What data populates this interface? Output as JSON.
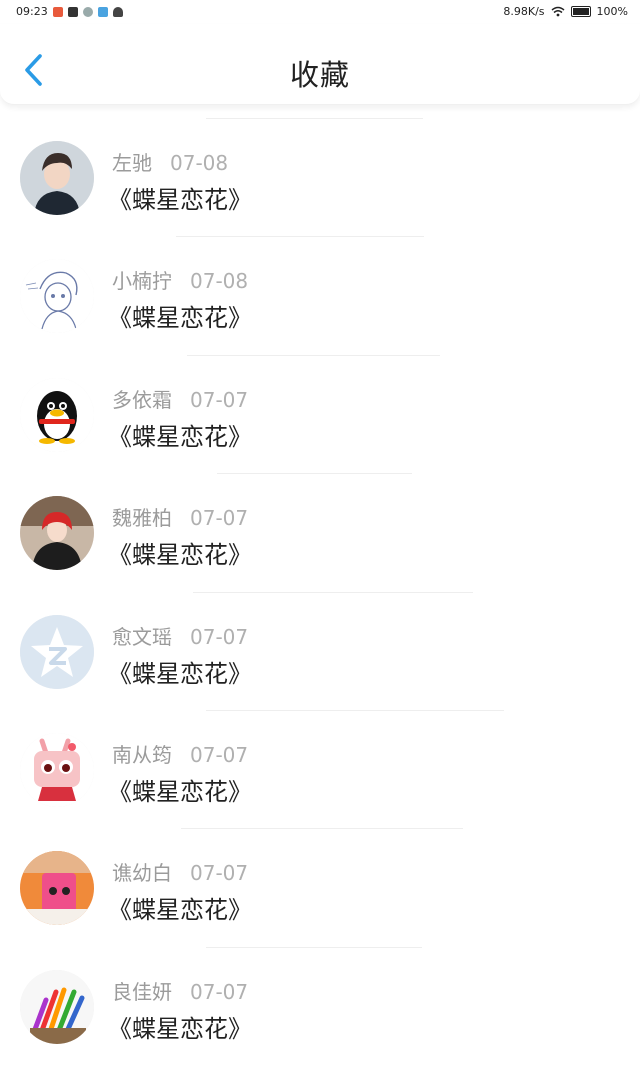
{
  "status_bar": {
    "time": "09:23",
    "network_speed": "8.98K/s",
    "battery": "100%"
  },
  "header": {
    "title": "收藏",
    "back_icon": "chevron-left-icon",
    "accent_color": "#2a9be6"
  },
  "items": [
    {
      "user": "左驰",
      "date": "07-08",
      "title": "《蝶星恋花》",
      "avatar": "photo-boy"
    },
    {
      "user": "小楠拧",
      "date": "07-08",
      "title": "《蝶星恋花》",
      "avatar": "sketch-girl"
    },
    {
      "user": "多依霜",
      "date": "07-07",
      "title": "《蝶星恋花》",
      "avatar": "qq-penguin"
    },
    {
      "user": "魏雅柏",
      "date": "07-07",
      "title": "《蝶星恋花》",
      "avatar": "photo-girl-red"
    },
    {
      "user": "愈文瑶",
      "date": "07-07",
      "title": "《蝶星恋花》",
      "avatar": "qzone-star"
    },
    {
      "user": "南从筠",
      "date": "07-07",
      "title": "《蝶星恋花》",
      "avatar": "cartoon-pink"
    },
    {
      "user": "谯幼白",
      "date": "07-07",
      "title": "《蝶星恋花》",
      "avatar": "photo-pink-cup"
    },
    {
      "user": "良佳妍",
      "date": "07-07",
      "title": "《蝶星恋花》",
      "avatar": "photo-pencils"
    }
  ]
}
